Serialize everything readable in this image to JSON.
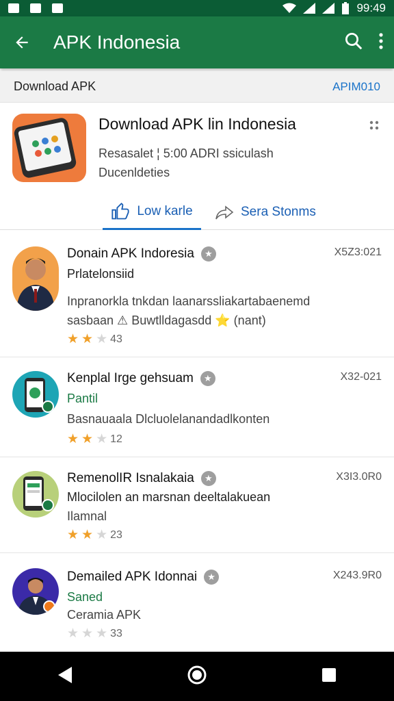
{
  "status_bar": {
    "time": "99:49"
  },
  "app_bar": {
    "title": "APK Indonesia"
  },
  "sub_header": {
    "label": "Download APK",
    "right": "APIM010"
  },
  "card": {
    "title": "Download APK lin Indonesia",
    "desc1": "Resasalet ¦ 5:00 ADRI ssiculash",
    "desc2": "Ducenldeties",
    "tab_like": "Low karle",
    "tab_share": "Sera Stonms"
  },
  "items": [
    {
      "title": "Donain APK Indoresia",
      "code": "X5Z3:021",
      "sub": "Prlatelonsiid",
      "sub_color": "#212121",
      "line1": "Inpranorkla tnkdan laanarssliakartabaenemd",
      "line2": "sasbaan ⚠ Buwtlldagasdd ⭐ (nant)",
      "rating": "43",
      "stars_on": 2
    },
    {
      "title": "Kenplal Irge gehsuam",
      "code": "X32-021",
      "sub": "Pantil",
      "sub_color": "#1b7a45",
      "line1": "Basnauaala Dlcluolelanandadlkonten",
      "rating": "12",
      "stars_on": 2
    },
    {
      "title": "RemenolIR Isnalakaia",
      "code": "X3I3.0R0",
      "sub": "Mlocilolen an marsnan deeltalakuean",
      "sub_color": "#212121",
      "line1": "Ilamnal",
      "rating": "23",
      "stars_on": 2
    },
    {
      "title": "Demailed APK Idonnai",
      "code": "X243.9R0",
      "sub": "Saned",
      "sub_color": "#1b7a45",
      "line1": "Ceramia APK",
      "rating": "33",
      "stars_on": 0
    }
  ],
  "colors": {
    "primary": "#1b7a45",
    "status": "#0b5c35",
    "accent": "#1a73c9",
    "star": "#f0a02a"
  }
}
